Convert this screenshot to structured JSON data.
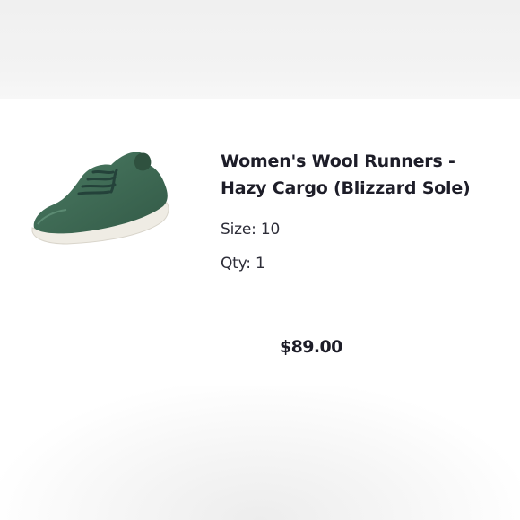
{
  "product": {
    "title_line1": "Women's Wool Runners -",
    "title_line2": "Hazy Cargo (Blizzard Sole)",
    "size_label": "Size:",
    "size_value": "10",
    "qty_label": "Qty:",
    "qty_value": "1",
    "price": "$89.00",
    "image_icon": "wool-sneaker-image",
    "colors": {
      "shoe_upper": "#3f6b55",
      "shoe_sole": "#efece4",
      "text": "#1d1d28"
    }
  }
}
